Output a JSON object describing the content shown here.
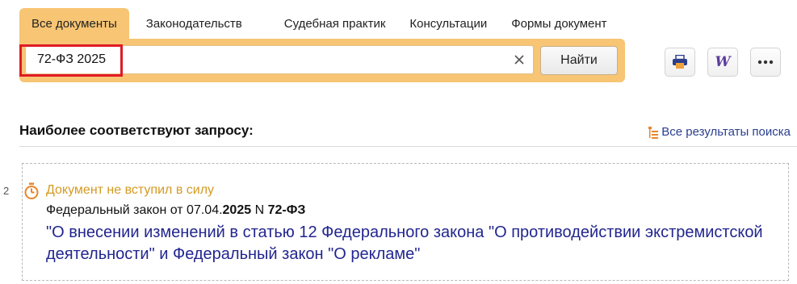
{
  "tabs": [
    {
      "label": "Все документы"
    },
    {
      "label": "Законодательств"
    },
    {
      "label": "Судебная практик"
    },
    {
      "label": "Консультации"
    },
    {
      "label": "Формы документ"
    }
  ],
  "search": {
    "value": "72-ФЗ 2025",
    "button_label": "Найти"
  },
  "toolbar": {
    "print_icon": "printer-icon",
    "word_icon": "word-export-icon",
    "word_glyph": "W",
    "more_icon": "more-icon"
  },
  "results": {
    "section_title": "Наиболее соответствуют запросу:",
    "all_results_label": "Все результаты поиска",
    "items": [
      {
        "number": "2",
        "status": "Документ не вступил в силу",
        "meta_prefix": "Федеральный закон от 07.04.",
        "meta_year": "2025",
        "meta_mid": " N ",
        "meta_num": "72-ФЗ",
        "title": "\"О внесении изменений в статью 12 Федерального закона \"О противодействии экстремистской деятельности\" и Федеральный закон \"О рекламе\""
      }
    ]
  },
  "colors": {
    "accent": "#f7c573",
    "status": "#d49a22",
    "link": "#22268f",
    "highlight": "#e01b24"
  }
}
